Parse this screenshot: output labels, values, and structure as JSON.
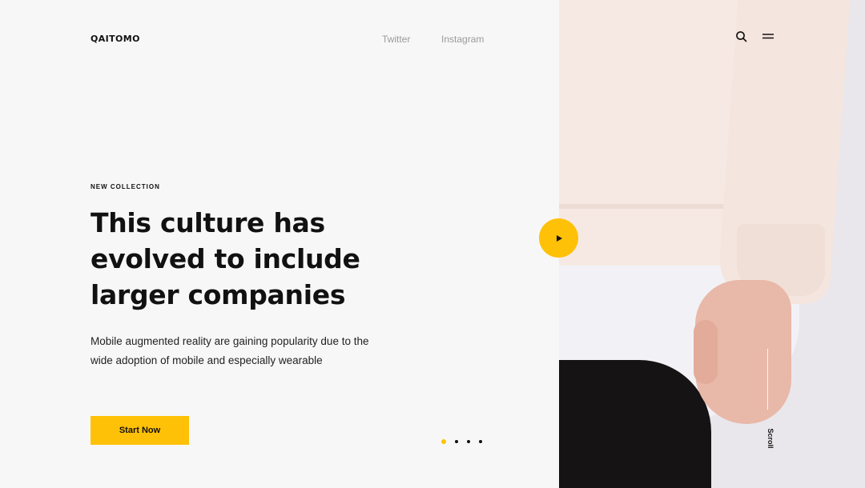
{
  "header": {
    "logo": "QAITOMO",
    "social": [
      "Twitter",
      "Instagram"
    ]
  },
  "hero": {
    "eyebrow": "NEW COLLECTION",
    "headline": "This culture has evolved to include larger companies",
    "description": "Mobile augmented reality are gaining popularity due to the wide adoption of mobile and especially wearable",
    "cta_label": "Start Now"
  },
  "carousel": {
    "slide_count": 4,
    "active_index": 0
  },
  "side": {
    "scroll_label": "Scroll"
  },
  "icons": {
    "search": "search-icon",
    "menu": "menu-icon",
    "play": "play-icon"
  },
  "colors": {
    "accent": "#ffc107",
    "background": "#f7f7f7",
    "text": "#111111",
    "muted": "#9a9a9a"
  }
}
